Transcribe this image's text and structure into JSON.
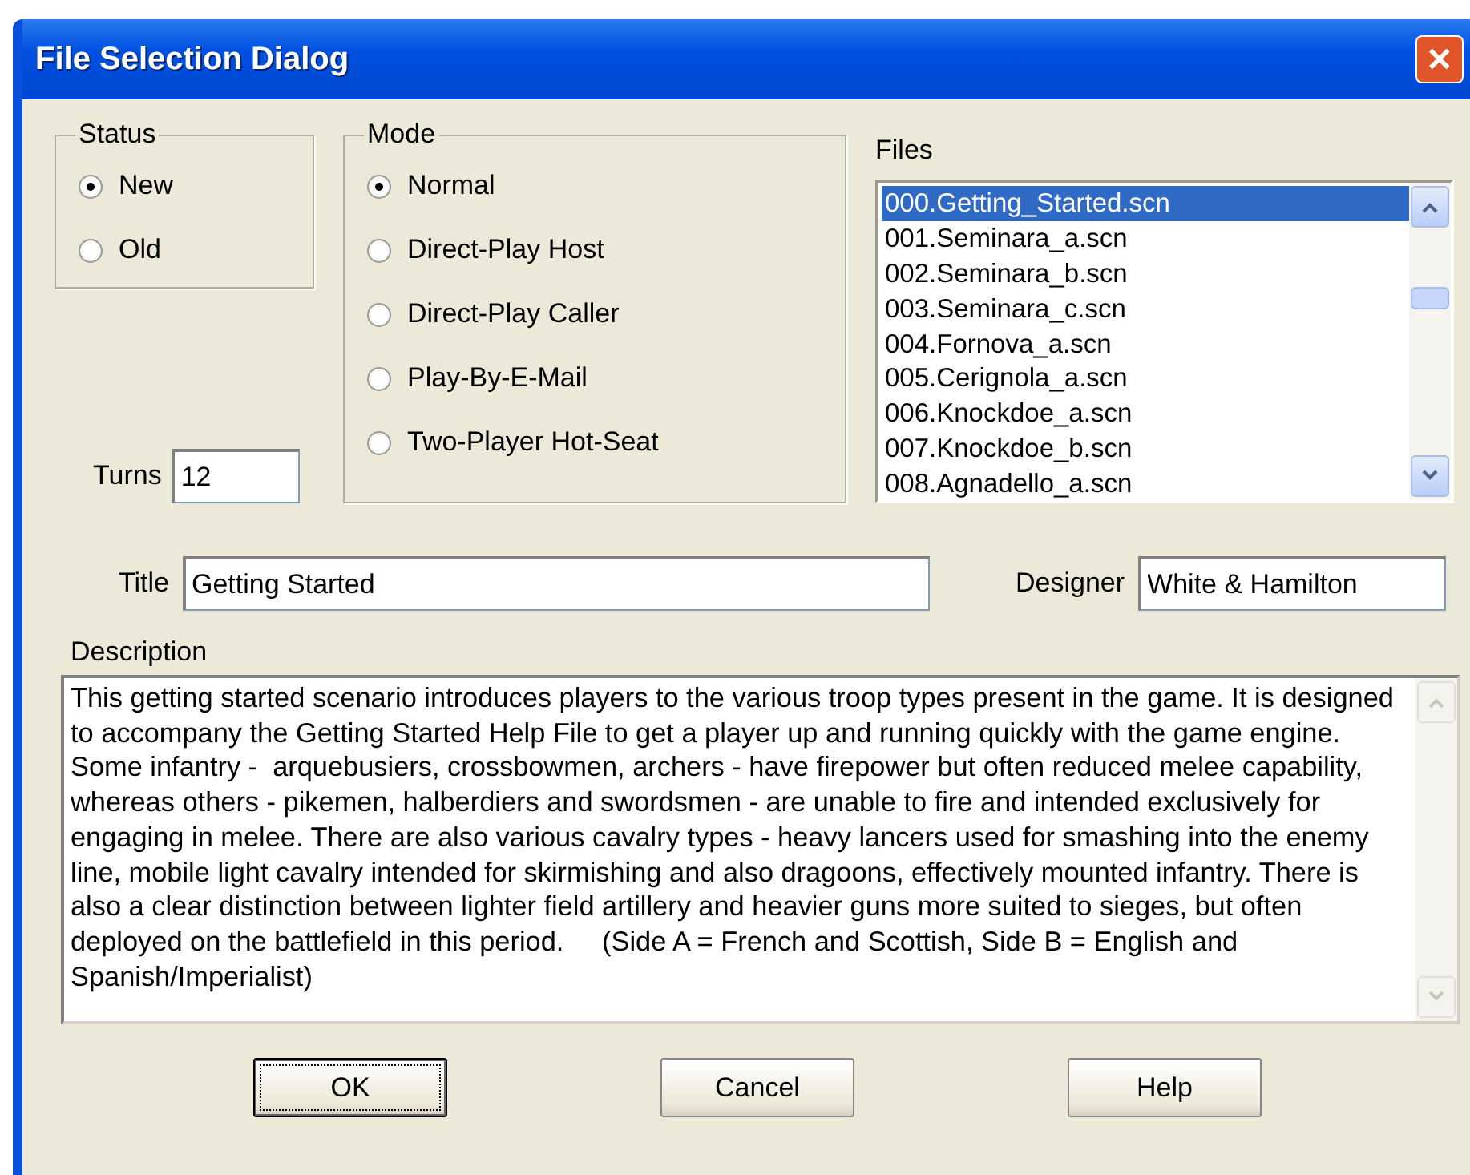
{
  "window": {
    "title": "File Selection Dialog",
    "close": "✕"
  },
  "status": {
    "label": "Status",
    "options": [
      {
        "label": "New",
        "selected": true
      },
      {
        "label": "Old",
        "selected": false
      }
    ]
  },
  "mode": {
    "label": "Mode",
    "options": [
      {
        "label": "Normal",
        "selected": true
      },
      {
        "label": "Direct-Play Host",
        "selected": false
      },
      {
        "label": "Direct-Play Caller",
        "selected": false
      },
      {
        "label": "Play-By-E-Mail",
        "selected": false
      },
      {
        "label": "Two-Player Hot-Seat",
        "selected": false
      }
    ]
  },
  "turns": {
    "label": "Turns",
    "value": "12"
  },
  "files": {
    "label": "Files",
    "items": [
      {
        "name": "000.Getting_Started.scn",
        "selected": true
      },
      {
        "name": "001.Seminara_a.scn",
        "selected": false
      },
      {
        "name": "002.Seminara_b.scn",
        "selected": false
      },
      {
        "name": "003.Seminara_c.scn",
        "selected": false
      },
      {
        "name": "004.Fornova_a.scn",
        "selected": false
      },
      {
        "name": "005.Cerignola_a.scn",
        "selected": false
      },
      {
        "name": "006.Knockdoe_a.scn",
        "selected": false
      },
      {
        "name": "007.Knockdoe_b.scn",
        "selected": false
      },
      {
        "name": "008.Agnadello_a.scn",
        "selected": false
      }
    ]
  },
  "title_field": {
    "label": "Title",
    "value": "Getting Started"
  },
  "designer": {
    "label": "Designer",
    "value": "White & Hamilton"
  },
  "description": {
    "label": "Description",
    "value": "This getting started scenario introduces players to the various troop types present in the game. It is designed to accompany the Getting Started Help File to get a player up and running quickly with the game engine. Some infantry -  arquebusiers, crossbowmen, archers - have firepower but often reduced melee capability, whereas others - pikemen, halberdiers and swordsmen - are unable to fire and intended exclusively for engaging in melee. There are also various cavalry types - heavy lancers used for smashing into the enemy line, mobile light cavalry intended for skirmishing and also dragoons, effectively mounted infantry. There is also a clear distinction between lighter field artillery and heavier guns more suited to sieges, but often deployed on the battlefield in this period.     (Side A = French and Scottish, Side B = English and Spanish/Imperialist)"
  },
  "buttons": [
    {
      "label": "OK",
      "focused": true
    },
    {
      "label": "Cancel",
      "focused": false
    },
    {
      "label": "Help",
      "focused": false
    }
  ]
}
